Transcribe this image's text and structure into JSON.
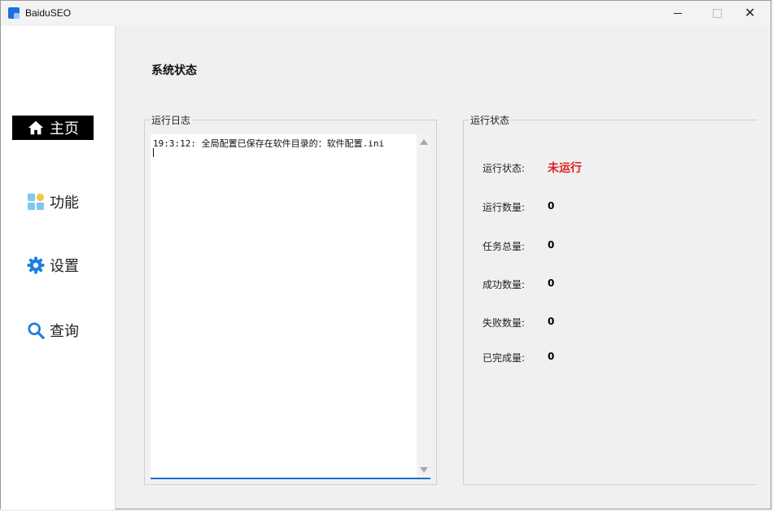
{
  "window": {
    "title": "BaiduSEO",
    "close_glyph": "✕"
  },
  "sidebar": {
    "items": [
      {
        "label": "主页",
        "icon": "home-icon",
        "active": true
      },
      {
        "label": "功能",
        "icon": "apps-grid-icon",
        "active": false
      },
      {
        "label": "设置",
        "icon": "gear-icon",
        "active": false
      },
      {
        "label": "查询",
        "icon": "search-icon",
        "active": false
      }
    ]
  },
  "main": {
    "title": "系统状态",
    "log_group": {
      "title": "运行日志",
      "log_text": "19:3:12: 全局配置已保存在软件目录的：软件配置.ini"
    },
    "status_group": {
      "title": "运行状态",
      "rows": [
        {
          "label": "运行状态:",
          "value": "未运行",
          "color": "#e02020"
        },
        {
          "label": "运行数量:",
          "value": "0"
        },
        {
          "label": "任务总量:",
          "value": "0"
        },
        {
          "label": "成功数量:",
          "value": "0"
        },
        {
          "label": "失败数量:",
          "value": "0"
        },
        {
          "label": "已完成量:",
          "value": "0"
        }
      ]
    }
  },
  "colors": {
    "accent_blue": "#1a6fd0",
    "status_red": "#e02020",
    "sidebar_active_bg": "#000000"
  }
}
